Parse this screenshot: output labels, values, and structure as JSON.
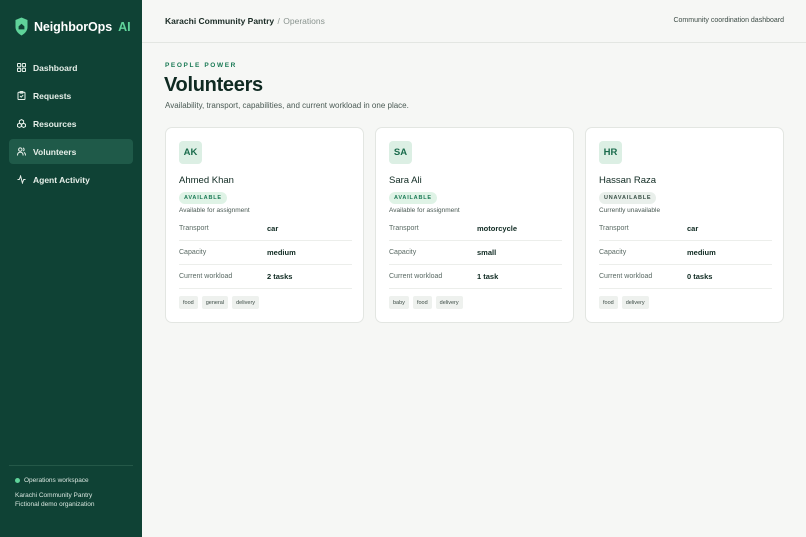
{
  "brand": {
    "name": "NeighborOps",
    "suffix": "AI",
    "accent": "#5fd39a"
  },
  "sidebar": {
    "items": [
      {
        "label": "Dashboard",
        "icon": "grid-icon",
        "active": false
      },
      {
        "label": "Requests",
        "icon": "clipboard-icon",
        "active": false
      },
      {
        "label": "Resources",
        "icon": "boxes-icon",
        "active": false
      },
      {
        "label": "Volunteers",
        "icon": "users-icon",
        "active": true
      },
      {
        "label": "Agent Activity",
        "icon": "activity-icon",
        "active": false
      }
    ],
    "footer": {
      "workspace": "Operations workspace",
      "org": "Karachi Community Pantry",
      "org_note": "Fictional demo organization"
    }
  },
  "topbar": {
    "breadcrumb": {
      "org": "Karachi Community Pantry",
      "separator": "/",
      "page": "Operations"
    },
    "right": "Community coordination dashboard"
  },
  "header": {
    "eyebrow": "PEOPLE POWER",
    "title": "Volunteers",
    "subtitle": "Availability, transport, capabilities, and current workload in one place."
  },
  "labels": {
    "transport": "Transport",
    "capacity": "Capacity",
    "workload": "Current workload"
  },
  "volunteers": [
    {
      "initials": "AK",
      "name": "Ahmed Khan",
      "status": "AVAILABLE",
      "status_kind": "available",
      "status_note": "Available for assignment",
      "transport": "car",
      "capacity": "medium",
      "workload": "2 tasks",
      "tags": [
        "food",
        "general",
        "delivery"
      ]
    },
    {
      "initials": "SA",
      "name": "Sara Ali",
      "status": "AVAILABLE",
      "status_kind": "available",
      "status_note": "Available for assignment",
      "transport": "motorcycle",
      "capacity": "small",
      "workload": "1 task",
      "tags": [
        "baby",
        "food",
        "delivery"
      ]
    },
    {
      "initials": "HR",
      "name": "Hassan Raza",
      "status": "UNAVAILABLE",
      "status_kind": "unavailable",
      "status_note": "Currently unavailable",
      "transport": "car",
      "capacity": "medium",
      "workload": "0 tasks",
      "tags": [
        "food",
        "delivery"
      ]
    }
  ]
}
